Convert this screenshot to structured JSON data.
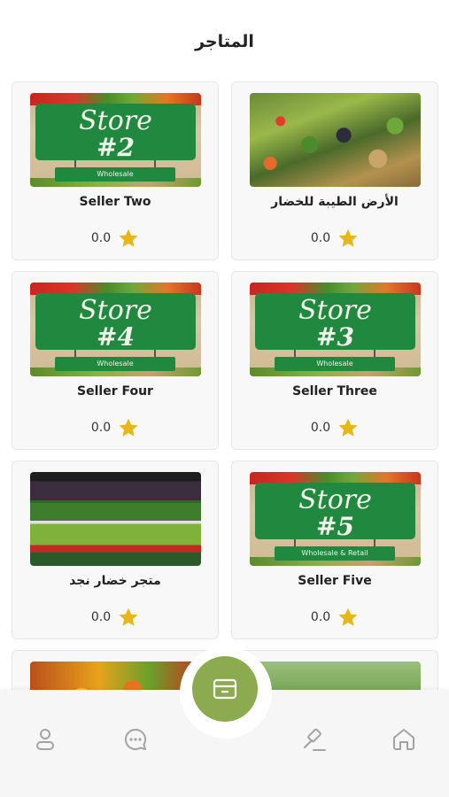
{
  "page": {
    "title": "المتاجر"
  },
  "stores": [
    {
      "name": "الأرض الطيبة للخضار",
      "rating": "0.0",
      "thumb": "market-photo"
    },
    {
      "name": "Seller Two",
      "rating": "0.0",
      "thumb": "store-sign",
      "sign": {
        "line1": "Store",
        "line2": "#2",
        "strip": "Wholesale"
      }
    },
    {
      "name": "Seller Three",
      "rating": "0.0",
      "thumb": "store-sign",
      "sign": {
        "line1": "Store",
        "line2": "#3",
        "strip": "Wholesale"
      }
    },
    {
      "name": "Seller Four",
      "rating": "0.0",
      "thumb": "store-sign",
      "sign": {
        "line1": "Store",
        "line2": "#4",
        "strip": "Wholesale"
      }
    },
    {
      "name": "Seller Five",
      "rating": "0.0",
      "thumb": "store-sign",
      "sign": {
        "line1": "Store",
        "line2": "#5",
        "strip": "Wholesale & Retail"
      }
    },
    {
      "name": "متجر خضار نجد",
      "rating": "0.0",
      "thumb": "shelf-photo"
    },
    {
      "name": "",
      "rating": "",
      "thumb": "garden-photo"
    },
    {
      "name": "",
      "rating": "",
      "thumb": "fruit-photo"
    }
  ],
  "bottom_nav": {
    "items": [
      "home-icon",
      "auction-icon",
      "store-icon",
      "chat-icon",
      "profile-icon"
    ],
    "accent_color": "#8bab4e"
  },
  "colors": {
    "star": "#e6b716",
    "sign_green": "#21893f"
  }
}
